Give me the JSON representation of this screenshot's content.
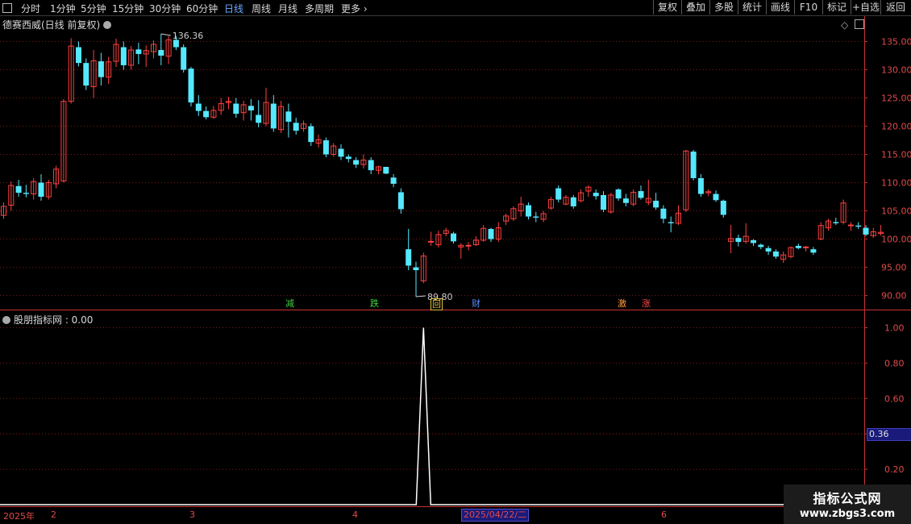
{
  "toolbar": {
    "periods": [
      "分时",
      "1分钟",
      "5分钟",
      "15分钟",
      "30分钟",
      "60分钟",
      "日线",
      "周线",
      "月线",
      "多周期",
      "更多 ›"
    ],
    "active_period": "日线",
    "buttons": [
      "复权",
      "叠加",
      "多股",
      "统计",
      "画线",
      "F10",
      "标记",
      "+自选",
      "返回"
    ]
  },
  "chart": {
    "title": "德赛西威(日线 前复权)",
    "high_marker": "136.36",
    "low_marker": "89.80",
    "price_ticks": [
      "135.00",
      "130.00",
      "125.00",
      "120.00",
      "115.00",
      "110.00",
      "105.00",
      "100.00",
      "95.00",
      "90.00"
    ],
    "signals": [
      {
        "text": "减",
        "color": "#3fd23f"
      },
      {
        "text": "跌",
        "color": "#3fd23f"
      },
      {
        "text": "回",
        "color": "#e0c040"
      },
      {
        "text": "财",
        "color": "#5a8cff"
      },
      {
        "text": "激",
        "color": "#ff9a3c"
      },
      {
        "text": "涨",
        "color": "#ff4a4a"
      }
    ]
  },
  "indicator": {
    "title": "股朋指标网 : 0.00",
    "ticks": [
      "1.00",
      "0.80",
      "0.60",
      "0.40",
      "0.20"
    ],
    "current_value": "0.36"
  },
  "date_axis": {
    "labels": [
      "2025年",
      "2",
      "3",
      "4",
      "6"
    ],
    "selected_date": "2025/04/22/二"
  },
  "watermark": {
    "line1": "指标公式网",
    "line2": "www.zbgs3.com"
  },
  "colors": {
    "up": "#ff4040",
    "down": "#55e8ff",
    "grid": "#7a1a1a",
    "axis": "#c83232",
    "line": "#ffffff"
  },
  "chart_data": {
    "type": "candlestick",
    "title": "德赛西威(日线 前复权)",
    "ylim": [
      88,
      137
    ],
    "candles": [
      [
        104.2,
        106.5,
        103.6,
        105.8
      ],
      [
        106.0,
        110.2,
        105.0,
        109.5
      ],
      [
        109.4,
        110.5,
        107.5,
        108.2
      ],
      [
        108.2,
        109.6,
        107.4,
        108.0
      ],
      [
        108.0,
        110.8,
        107.0,
        110.2
      ],
      [
        110.0,
        111.5,
        106.8,
        107.5
      ],
      [
        107.5,
        110.5,
        107.0,
        110.0
      ],
      [
        109.8,
        113.0,
        109.0,
        112.4
      ],
      [
        110.3,
        124.8,
        110.0,
        124.4
      ],
      [
        124.4,
        135.6,
        124.0,
        134.2
      ],
      [
        134.0,
        135.0,
        130.6,
        131.2
      ],
      [
        131.2,
        132.0,
        126.4,
        127.2
      ],
      [
        127.0,
        133.5,
        125.0,
        131.6
      ],
      [
        131.5,
        133.0,
        127.2,
        128.7
      ],
      [
        128.7,
        132.3,
        127.5,
        131.4
      ],
      [
        131.5,
        135.5,
        130.5,
        134.5
      ],
      [
        134.0,
        135.0,
        130.0,
        130.8
      ],
      [
        130.8,
        134.2,
        130.0,
        133.5
      ],
      [
        133.6,
        134.8,
        131.0,
        132.8
      ],
      [
        132.8,
        134.3,
        130.5,
        133.4
      ],
      [
        133.2,
        135.2,
        132.0,
        134.5
      ],
      [
        133.5,
        136.36,
        130.8,
        132.5
      ],
      [
        132.4,
        136.0,
        131.0,
        135.3
      ],
      [
        135.3,
        136.0,
        133.5,
        134.0
      ],
      [
        134.0,
        134.5,
        129.5,
        130.0
      ],
      [
        130.2,
        130.5,
        123.5,
        124.2
      ],
      [
        124.0,
        125.5,
        121.8,
        122.7
      ],
      [
        122.7,
        123.5,
        121.2,
        121.6
      ],
      [
        121.6,
        123.6,
        121.3,
        122.8
      ],
      [
        122.8,
        125.0,
        122.0,
        124.0
      ],
      [
        124.2,
        125.2,
        123.0,
        124.4
      ],
      [
        124.0,
        125.0,
        121.5,
        122.2
      ],
      [
        122.4,
        124.5,
        121.0,
        123.8
      ],
      [
        123.6,
        124.8,
        121.0,
        122.8
      ],
      [
        122.0,
        124.6,
        119.8,
        120.6
      ],
      [
        120.5,
        126.8,
        120.0,
        124.2
      ],
      [
        124.0,
        125.5,
        119.0,
        119.6
      ],
      [
        119.4,
        124.5,
        118.8,
        123.5
      ],
      [
        122.6,
        124.0,
        118.0,
        120.8
      ],
      [
        120.6,
        121.5,
        118.5,
        119.2
      ],
      [
        119.6,
        121.0,
        119.0,
        120.4
      ],
      [
        120.0,
        120.5,
        116.5,
        117.2
      ],
      [
        117.0,
        118.5,
        116.2,
        117.6
      ],
      [
        117.5,
        118.0,
        114.5,
        115.0
      ],
      [
        115.0,
        117.0,
        114.6,
        116.5
      ],
      [
        116.0,
        116.8,
        114.0,
        114.6
      ],
      [
        114.6,
        115.0,
        113.6,
        114.2
      ],
      [
        114.0,
        114.5,
        112.6,
        113.2
      ],
      [
        113.2,
        115.0,
        112.5,
        114.0
      ],
      [
        114.0,
        114.5,
        111.5,
        112.2
      ],
      [
        112.2,
        113.0,
        111.5,
        112.8
      ],
      [
        112.8,
        112.6,
        111.5,
        111.6
      ],
      [
        110.9,
        111.5,
        109.2,
        109.8
      ],
      [
        108.3,
        109.0,
        104.5,
        105.3
      ],
      [
        98.2,
        101.8,
        94.5,
        95.3
      ],
      [
        95.0,
        96.0,
        89.8,
        94.5
      ],
      [
        92.6,
        97.6,
        92.2,
        97.0
      ],
      [
        99.5,
        101.3,
        98.8,
        99.6
      ],
      [
        99.0,
        101.5,
        98.5,
        100.8
      ],
      [
        101.0,
        102.0,
        100.5,
        101.5
      ],
      [
        101.0,
        101.3,
        99.2,
        99.6
      ],
      [
        98.6,
        99.3,
        96.5,
        98.9
      ],
      [
        98.8,
        99.5,
        98.0,
        98.9
      ],
      [
        99.0,
        100.5,
        98.8,
        99.8
      ],
      [
        99.8,
        102.5,
        99.5,
        101.9
      ],
      [
        101.8,
        102.0,
        99.5,
        100.0
      ],
      [
        100.0,
        103.0,
        99.5,
        102.0
      ],
      [
        103.2,
        104.5,
        102.5,
        104.1
      ],
      [
        103.6,
        105.8,
        103.2,
        105.4
      ],
      [
        105.0,
        107.5,
        104.0,
        106.2
      ],
      [
        106.0,
        106.5,
        103.5,
        104.0
      ],
      [
        104.0,
        104.8,
        103.0,
        103.8
      ],
      [
        103.5,
        105.0,
        103.0,
        104.5
      ],
      [
        105.5,
        107.5,
        105.2,
        107.0
      ],
      [
        109.0,
        109.5,
        106.5,
        107.0
      ],
      [
        106.2,
        107.8,
        106.0,
        107.4
      ],
      [
        107.4,
        107.8,
        105.4,
        105.8
      ],
      [
        106.8,
        108.8,
        106.5,
        108.2
      ],
      [
        108.5,
        109.5,
        107.5,
        109.2
      ],
      [
        108.2,
        108.8,
        107.0,
        107.6
      ],
      [
        107.8,
        108.5,
        104.8,
        105.2
      ],
      [
        104.8,
        108.2,
        104.5,
        107.8
      ],
      [
        108.8,
        109.0,
        106.8,
        107.2
      ],
      [
        107.2,
        108.0,
        105.8,
        106.4
      ],
      [
        106.2,
        108.8,
        105.8,
        108.3
      ],
      [
        108.5,
        109.5,
        107.0,
        107.3
      ],
      [
        106.5,
        110.5,
        106.0,
        107.2
      ],
      [
        106.8,
        108.2,
        105.2,
        105.6
      ],
      [
        105.4,
        106.0,
        102.8,
        103.6
      ],
      [
        103.0,
        104.0,
        101.2,
        102.8
      ],
      [
        102.8,
        106.0,
        102.5,
        104.6
      ],
      [
        105.2,
        115.8,
        104.8,
        115.6
      ],
      [
        115.5,
        115.8,
        110.4,
        110.8
      ],
      [
        110.8,
        111.5,
        107.5,
        108.0
      ],
      [
        108.2,
        108.8,
        107.6,
        108.4
      ],
      [
        108.0,
        108.6,
        106.6,
        106.9
      ],
      [
        106.8,
        107.0,
        103.8,
        104.3
      ],
      [
        99.6,
        102.5,
        97.5,
        100.1
      ],
      [
        100.2,
        100.8,
        98.7,
        99.5
      ],
      [
        99.6,
        102.8,
        99.2,
        100.5
      ],
      [
        99.8,
        100.0,
        98.8,
        99.3
      ],
      [
        99.0,
        99.2,
        98.2,
        98.6
      ],
      [
        98.4,
        98.8,
        97.2,
        97.8
      ],
      [
        97.8,
        98.2,
        96.5,
        96.9
      ],
      [
        96.4,
        97.8,
        95.8,
        97.2
      ],
      [
        96.9,
        98.7,
        96.6,
        98.5
      ],
      [
        98.8,
        99.2,
        98.2,
        98.4
      ],
      [
        98.5,
        98.8,
        97.8,
        98.6
      ],
      [
        98.2,
        98.6,
        97.2,
        97.6
      ],
      [
        100.0,
        103.0,
        99.8,
        102.4
      ],
      [
        102.0,
        103.6,
        101.5,
        103.2
      ],
      [
        103.0,
        103.8,
        102.5,
        102.8
      ],
      [
        103.0,
        107.0,
        102.6,
        106.4
      ],
      [
        102.4,
        103.0,
        101.5,
        102.5
      ],
      [
        102.4,
        103.0,
        101.8,
        102.2
      ],
      [
        102.0,
        102.5,
        100.5,
        100.8
      ],
      [
        100.6,
        102.0,
        100.2,
        101.3
      ],
      [
        101.0,
        102.5,
        100.6,
        101.2
      ]
    ],
    "indicator_values": [
      0,
      0,
      0,
      0,
      0,
      0,
      0,
      0,
      0,
      0,
      0,
      0,
      0,
      0,
      0,
      0,
      0,
      0,
      0,
      0,
      0,
      0,
      0,
      0,
      0,
      0,
      0,
      0,
      0,
      0,
      0,
      0,
      0,
      0,
      0,
      0,
      0,
      0,
      0,
      0,
      0,
      0,
      0,
      0,
      0,
      0,
      0,
      0,
      0,
      0,
      0,
      0,
      0,
      0,
      0,
      0,
      1,
      0,
      0,
      0,
      0,
      0,
      0,
      0,
      0,
      0,
      0,
      0,
      0,
      0,
      0,
      0,
      0,
      0,
      0,
      0,
      0,
      0,
      0,
      0,
      0,
      0,
      0,
      0,
      0,
      0,
      0,
      0,
      0,
      0,
      0,
      0,
      0,
      0,
      0,
      0,
      0,
      0,
      0,
      0,
      0,
      0,
      0,
      0,
      0,
      0,
      0,
      0,
      0,
      0,
      0,
      0,
      0,
      0,
      0,
      0,
      0,
      0
    ],
    "indicator_ylim": [
      0,
      1.2
    ]
  }
}
